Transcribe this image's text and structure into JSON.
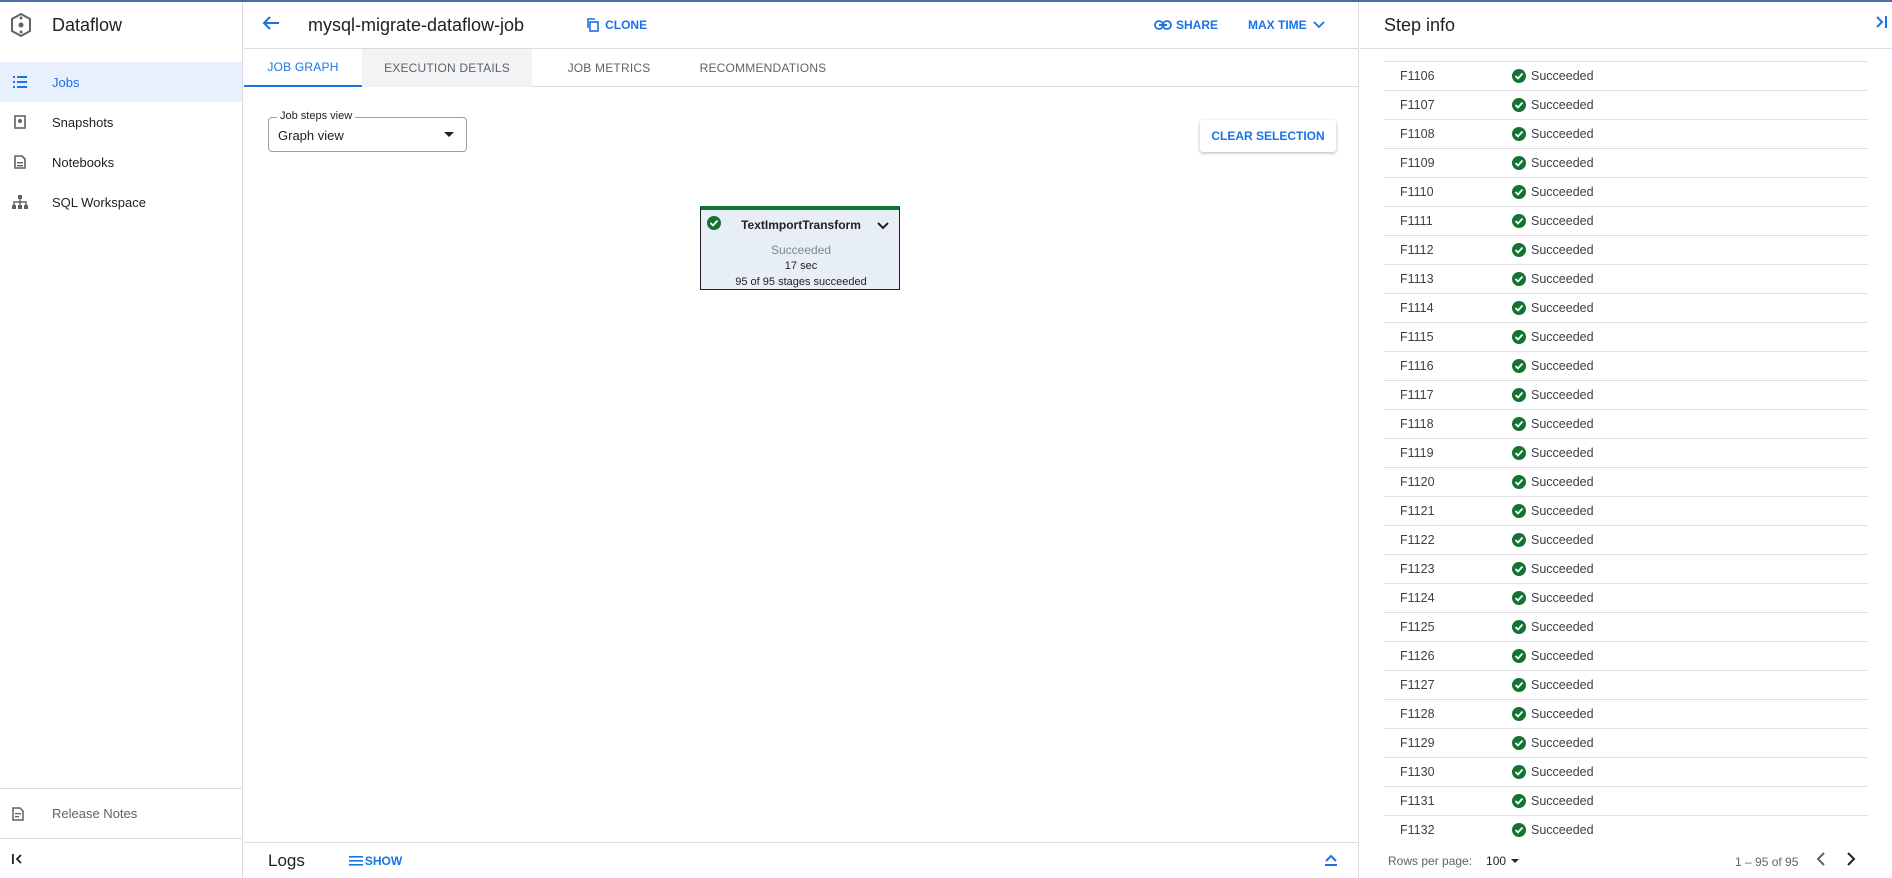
{
  "app": {
    "title": "Dataflow"
  },
  "sidebar": {
    "items": [
      {
        "label": "Jobs",
        "icon": "list-icon",
        "active": true
      },
      {
        "label": "Snapshots",
        "icon": "snapshot-icon",
        "active": false
      },
      {
        "label": "Notebooks",
        "icon": "notebook-icon",
        "active": false
      },
      {
        "label": "SQL Workspace",
        "icon": "hierarchy-icon",
        "active": false
      }
    ],
    "release_notes": "Release Notes"
  },
  "header": {
    "job_name": "mysql-migrate-dataflow-job",
    "clone_label": "CLONE",
    "share_label": "SHARE",
    "max_time_label": "MAX TIME"
  },
  "tabs": [
    {
      "label": "JOB GRAPH",
      "active": true
    },
    {
      "label": "EXECUTION DETAILS",
      "active": false
    },
    {
      "label": "JOB METRICS",
      "active": false
    },
    {
      "label": "RECOMMENDATIONS",
      "active": false
    }
  ],
  "graph": {
    "steps_view_label": "Job steps view",
    "steps_view_value": "Graph view",
    "clear_selection_label": "CLEAR SELECTION",
    "node": {
      "name": "TextImportTransform",
      "status": "Succeeded",
      "duration": "17 sec",
      "stages": "95 of 95 stages succeeded"
    }
  },
  "logs": {
    "title": "Logs",
    "show_label": "SHOW"
  },
  "step_info": {
    "title": "Step info",
    "rows": [
      {
        "id": "F1106",
        "status": "Succeeded"
      },
      {
        "id": "F1107",
        "status": "Succeeded"
      },
      {
        "id": "F1108",
        "status": "Succeeded"
      },
      {
        "id": "F1109",
        "status": "Succeeded"
      },
      {
        "id": "F1110",
        "status": "Succeeded"
      },
      {
        "id": "F1111",
        "status": "Succeeded"
      },
      {
        "id": "F1112",
        "status": "Succeeded"
      },
      {
        "id": "F1113",
        "status": "Succeeded"
      },
      {
        "id": "F1114",
        "status": "Succeeded"
      },
      {
        "id": "F1115",
        "status": "Succeeded"
      },
      {
        "id": "F1116",
        "status": "Succeeded"
      },
      {
        "id": "F1117",
        "status": "Succeeded"
      },
      {
        "id": "F1118",
        "status": "Succeeded"
      },
      {
        "id": "F1119",
        "status": "Succeeded"
      },
      {
        "id": "F1120",
        "status": "Succeeded"
      },
      {
        "id": "F1121",
        "status": "Succeeded"
      },
      {
        "id": "F1122",
        "status": "Succeeded"
      },
      {
        "id": "F1123",
        "status": "Succeeded"
      },
      {
        "id": "F1124",
        "status": "Succeeded"
      },
      {
        "id": "F1125",
        "status": "Succeeded"
      },
      {
        "id": "F1126",
        "status": "Succeeded"
      },
      {
        "id": "F1127",
        "status": "Succeeded"
      },
      {
        "id": "F1128",
        "status": "Succeeded"
      },
      {
        "id": "F1129",
        "status": "Succeeded"
      },
      {
        "id": "F1130",
        "status": "Succeeded"
      },
      {
        "id": "F1131",
        "status": "Succeeded"
      },
      {
        "id": "F1132",
        "status": "Succeeded"
      }
    ],
    "rows_per_page_label": "Rows per page:",
    "rows_per_page_value": "100",
    "range_label": "1 – 95 of 95"
  },
  "colors": {
    "accent": "#1a73e8",
    "success": "#137333",
    "node_bg": "#e8eef7"
  }
}
